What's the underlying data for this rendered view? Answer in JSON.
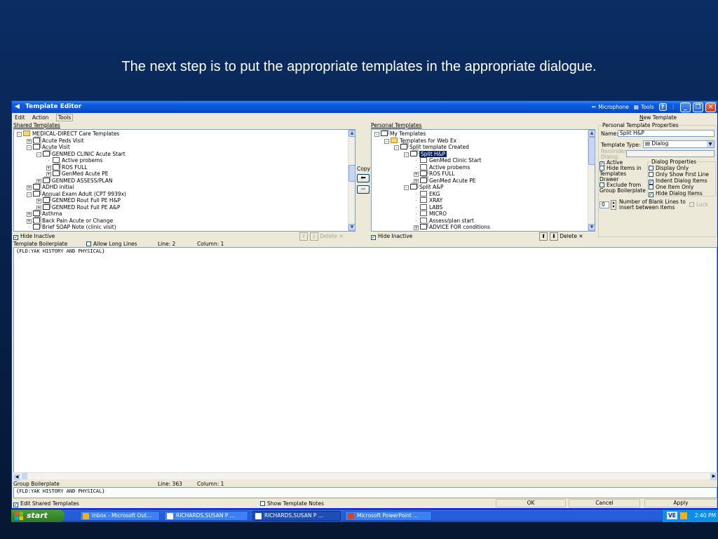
{
  "slide": {
    "caption": "The next step is to put the appropriate templates in the appropriate dialogue."
  },
  "window": {
    "title": "Template Editor",
    "tb_microphone": "Microphone",
    "tb_tools": "Tools",
    "menu": [
      "Edit",
      "Action",
      "Tools"
    ],
    "new_template": "New Template"
  },
  "shared": {
    "heading": "Shared Templates",
    "items": [
      {
        "text": "MEDICAL-DIRECT Care Templates",
        "indent": 0,
        "icon": "folder",
        "pm": "-"
      },
      {
        "text": "Acute Peds Visit",
        "indent": 1,
        "icon": "group",
        "pm": "+"
      },
      {
        "text": "Acute Visit",
        "indent": 1,
        "icon": "group",
        "pm": "-"
      },
      {
        "text": "GENMED CLINIC Acute Start",
        "indent": 2,
        "icon": "group",
        "pm": "-"
      },
      {
        "text": "Active probems",
        "indent": 3,
        "icon": "doc",
        "pm": ""
      },
      {
        "text": "ROS FULL",
        "indent": 3,
        "icon": "group",
        "pm": "+"
      },
      {
        "text": "GenMed Acute PE",
        "indent": 3,
        "icon": "group",
        "pm": "+"
      },
      {
        "text": "GENMED ASSESS/PLAN",
        "indent": 2,
        "icon": "group",
        "pm": "+"
      },
      {
        "text": "ADHD initial",
        "indent": 1,
        "icon": "group",
        "pm": "+"
      },
      {
        "text": "Annual Exam Adult (CPT 9939x)",
        "indent": 1,
        "icon": "group",
        "pm": "-"
      },
      {
        "text": "GENMED Rout  Full PE H&P",
        "indent": 2,
        "icon": "group",
        "pm": "+"
      },
      {
        "text": "GENMED Rout Full PE A&P",
        "indent": 2,
        "icon": "group",
        "pm": "+"
      },
      {
        "text": "Asthma",
        "indent": 1,
        "icon": "group",
        "pm": "+"
      },
      {
        "text": "Back Pain Acute or Change",
        "indent": 1,
        "icon": "group",
        "pm": "+"
      },
      {
        "text": "Brief SOAP Note (clinic visit)",
        "indent": 1,
        "icon": "group",
        "pm": ""
      }
    ],
    "hide_inactive": "Hide Inactive",
    "delete": "Delete"
  },
  "copy_label": "Copy",
  "personal": {
    "heading": "Personal Templates",
    "items": [
      {
        "text": "My Templates",
        "indent": 0,
        "icon": "group",
        "pm": "-"
      },
      {
        "text": "Templates for Web Ex",
        "indent": 1,
        "icon": "folder",
        "pm": "-"
      },
      {
        "text": "Split template Created",
        "indent": 2,
        "icon": "group",
        "pm": "-"
      },
      {
        "text": "Split H&P",
        "indent": 3,
        "icon": "group",
        "pm": "-",
        "selected": true
      },
      {
        "text": "GenMed Clinic Start",
        "indent": 4,
        "icon": "doc",
        "pm": ""
      },
      {
        "text": "Active probems",
        "indent": 4,
        "icon": "doc",
        "pm": ""
      },
      {
        "text": "ROS FULL",
        "indent": 4,
        "icon": "group",
        "pm": "+"
      },
      {
        "text": "GenMed Acute PE",
        "indent": 4,
        "icon": "group",
        "pm": "+"
      },
      {
        "text": "Split A&P",
        "indent": 3,
        "icon": "group",
        "pm": "-"
      },
      {
        "text": "EKG",
        "indent": 4,
        "icon": "doc",
        "pm": ""
      },
      {
        "text": "XRAY",
        "indent": 4,
        "icon": "doc",
        "pm": ""
      },
      {
        "text": "LABS",
        "indent": 4,
        "icon": "doc",
        "pm": ""
      },
      {
        "text": "MICRO",
        "indent": 4,
        "icon": "doc",
        "pm": ""
      },
      {
        "text": "Assess/plan start",
        "indent": 4,
        "icon": "doc",
        "pm": ""
      },
      {
        "text": "ADVICE FOR conditions",
        "indent": 4,
        "icon": "group",
        "pm": "+"
      }
    ],
    "hide_inactive": "Hide Inactive",
    "delete": "Delete"
  },
  "props": {
    "group_title": "Personal Template Properties",
    "name_label": "Name:",
    "name_value": "Split H&P",
    "type_label": "Template Type:",
    "type_value": "Dialog",
    "reminder_label": "Reminder Dialog:",
    "active": "Active",
    "hide_items": "Hide Items in Templates Drawer",
    "exclude": "Exclude from Group Boilerplate",
    "dialog_props_title": "Dialog Properties",
    "display_only": "Display Only",
    "only_show_first": "Only Show First Line",
    "indent_dialog": "Indent Dialog Items",
    "one_item_only": "One Item Only",
    "hide_dialog": "Hide Dialog Items",
    "blank_lines_value": "0",
    "blank_lines_label": "Number of Blank Lines to insert between items",
    "lock": "Lock"
  },
  "boilerplate": {
    "label": "Template Boilerplate",
    "allow_long": "Allow Long Lines",
    "line": "Line: 2",
    "column": "Column: 1",
    "text": "{FLD:YAK HISTORY AND PHYSICAL}"
  },
  "group": {
    "label": "Group Boilerplate",
    "line": "Line: 363",
    "column": "Column: 1",
    "text": "{FLD:YAK HISTORY AND PHYSICAL}"
  },
  "footer": {
    "edit_shared": "Edit Shared Templates",
    "show_notes": "Show Template Notes",
    "ok": "OK",
    "cancel": "Cancel",
    "apply": "Apply"
  },
  "taskbar": {
    "start": "start",
    "items": [
      "Inbox - Microsoft Out...",
      "RICHARDS,SUSAN P ...",
      "RICHARDS,SUSAN P ...",
      "Microsoft PowerPoint ..."
    ],
    "tray_badge": "VE",
    "clock": "2:40 PM"
  },
  "colors": {
    "background": "#0b2d63",
    "titlebar": "#0a5ddf",
    "window": "#ece9d8",
    "selection": "#0a246a"
  }
}
